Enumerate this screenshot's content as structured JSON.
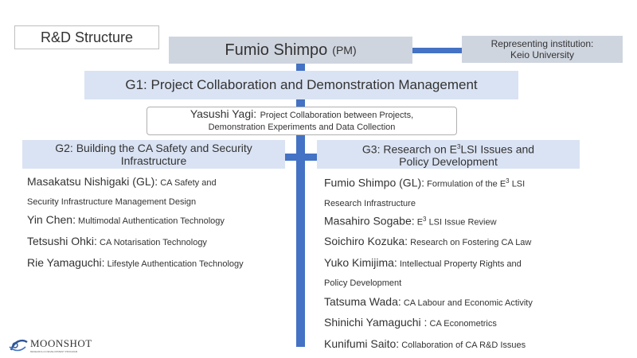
{
  "title": "R&D Structure",
  "pm": {
    "name": "Fumio Shimpo",
    "tag": "(PM)"
  },
  "institution": {
    "line1": "Representing institution:",
    "line2": "Keio University"
  },
  "g1": {
    "label": "G1: Project Collaboration and Demonstration Management"
  },
  "yagi": {
    "name": "Yasushi Yagi:",
    "desc1": "Project Collaboration between Projects,",
    "desc2": "Demonstration Experiments and Data Collection"
  },
  "g2": {
    "line1": "G2: Building the CA Safety and Security",
    "line2": "Infrastructure",
    "members": [
      {
        "name": "Masakatsu Nishigaki (GL):",
        "desc": "CA Safety and",
        "desc2": "Security Infrastructure Management Design"
      },
      {
        "name": "Yin Chen:",
        "desc": "Multimodal Authentication Technology"
      },
      {
        "name": "Tetsushi Ohki:",
        "desc": "CA Notarisation Technology"
      },
      {
        "name": "Rie Yamaguchi:",
        "desc": "Lifestyle Authentication Technology"
      }
    ]
  },
  "g3": {
    "line1a": "G3: Research on E",
    "line1sup": "3",
    "line1b": "LSI Issues and",
    "line2": "Policy Development",
    "members": [
      {
        "name": "Fumio Shimpo (GL):",
        "desc": "Formulation of the E",
        "sup": "3",
        "desc_b": "LSI",
        "desc2": "Research Infrastructure"
      },
      {
        "name": "Masahiro Sogabe:",
        "desc": "E",
        "sup": "3",
        "desc_b": "LSI Issue Review"
      },
      {
        "name": "Soichiro Kozuka:",
        "desc": "Research on Fostering CA Law"
      },
      {
        "name": "Yuko Kimijima:",
        "desc": "Intellectual Property Rights and",
        "desc2": "Policy Development"
      },
      {
        "name": "Tatsuma Wada:",
        "desc": "CA Labour and Economic Activity"
      },
      {
        "name": "Shinichi Yamaguchi :",
        "desc": "CA Econometrics"
      },
      {
        "name": "Kunifumi Saito:",
        "desc": "Collaboration of CA R&D Issues"
      }
    ]
  },
  "logo": {
    "text": "MOONSHOT",
    "sub": "RESEARCH & DEVELOPMENT PROGRAM"
  },
  "colors": {
    "connector": "#4472c4",
    "pm_fill": "#cfd5df",
    "group_fill": "#dae3f3"
  }
}
